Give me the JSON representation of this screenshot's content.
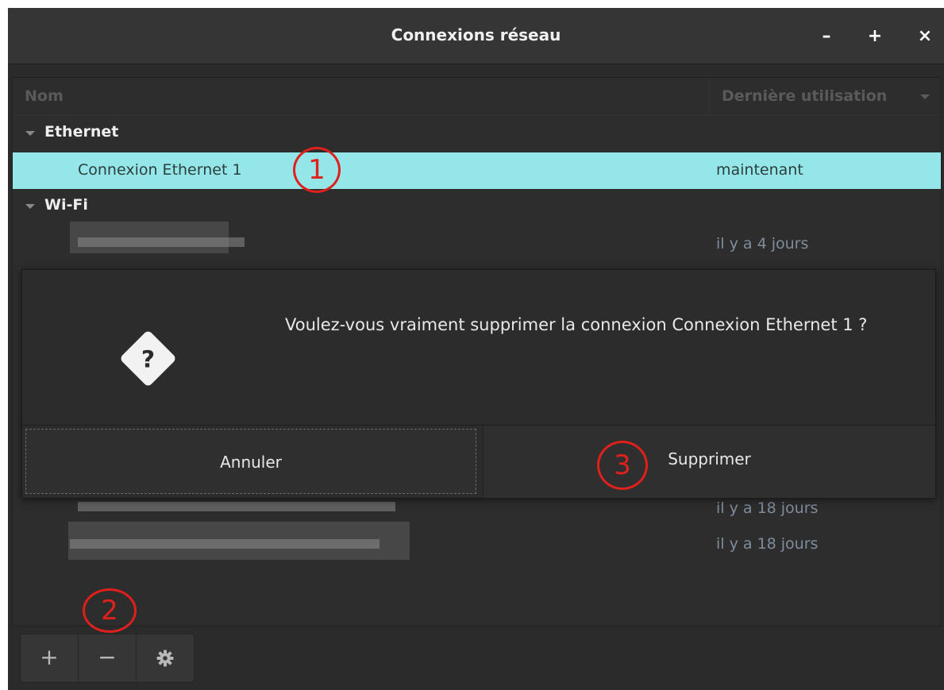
{
  "window": {
    "title": "Connexions réseau",
    "controls": {
      "minimize": "–",
      "maximize": "+",
      "close": "×"
    }
  },
  "list": {
    "columns": {
      "name": "Nom",
      "last_used": "Dernière utilisation"
    },
    "groups": [
      {
        "label": "Ethernet",
        "rows": [
          {
            "name": "Connexion Ethernet 1",
            "last_used": "maintenant",
            "selected": true
          }
        ]
      },
      {
        "label": "Wi-Fi",
        "rows": [
          {
            "name": "",
            "last_used": "il y a 4 jours"
          },
          {
            "name": "",
            "last_used": "il y a 18 jours"
          },
          {
            "name": "",
            "last_used": "il y a 18 jours"
          }
        ]
      }
    ]
  },
  "dialog": {
    "icon": "question-diamond-icon",
    "message": "Voulez-vous vraiment supprimer la connexion Connexion Ethernet 1 ?",
    "cancel_label": "Annuler",
    "delete_label": "Supprimer"
  },
  "toolbar": {
    "add": "+",
    "remove": "−",
    "settings": "gear-icon"
  },
  "annotations": {
    "step1": "1",
    "step2": "2",
    "step3": "3"
  },
  "colors": {
    "selection": "#95e6e8",
    "annotation": "#e0201b",
    "window_bg": "#2b2b2b"
  }
}
